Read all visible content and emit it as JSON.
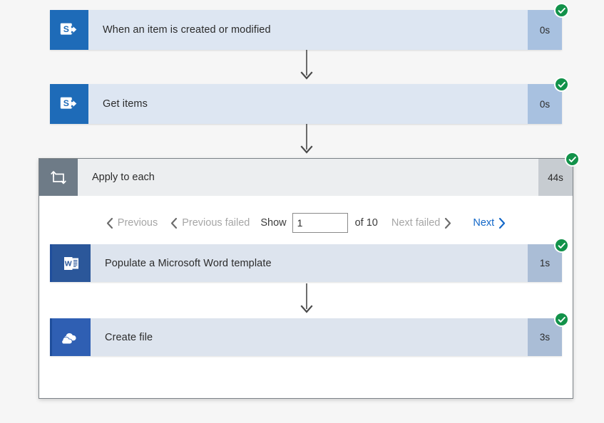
{
  "colors": {
    "page_background": "#f6f6f6",
    "card_background": "#dde6f2",
    "duration_background": "#a8c1e0",
    "success_green": "#12924a",
    "link_blue": "#1267c8",
    "disabled_gray": "#a6a6a6",
    "sharepoint_blue": "#1e6bb8",
    "word_blue": "#2b579a",
    "onedrive_blue": "#2f5fb3",
    "scope_icon_gray": "#6e7b87",
    "scope_header_gray": "#eceef0",
    "scope_duration_gray": "#c7ccd1"
  },
  "flow": {
    "steps": [
      {
        "title": "When an item is created or modified",
        "duration": "0s",
        "icon": "sharepoint-icon",
        "status": "succeeded",
        "status_icon": "check-circle-icon"
      },
      {
        "title": "Get items",
        "duration": "0s",
        "icon": "sharepoint-icon",
        "status": "succeeded",
        "status_icon": "check-circle-icon"
      }
    ],
    "scope": {
      "title": "Apply to each",
      "duration": "44s",
      "icon": "repeat-loop-icon",
      "status": "succeeded",
      "status_icon": "check-circle-icon",
      "pager": {
        "previous_label": "Previous",
        "previous_failed_label": "Previous failed",
        "show_label": "Show",
        "page_value": "1",
        "page_placeholder": "",
        "of_label": "of 10",
        "next_failed_label": "Next failed",
        "next_label": "Next"
      },
      "steps": [
        {
          "title": "Populate a Microsoft Word template",
          "duration": "1s",
          "icon": "word-icon",
          "status": "succeeded",
          "status_icon": "check-circle-icon"
        },
        {
          "title": "Create file",
          "duration": "3s",
          "icon": "onedrive-icon",
          "status": "succeeded",
          "status_icon": "check-circle-icon"
        }
      ]
    }
  }
}
